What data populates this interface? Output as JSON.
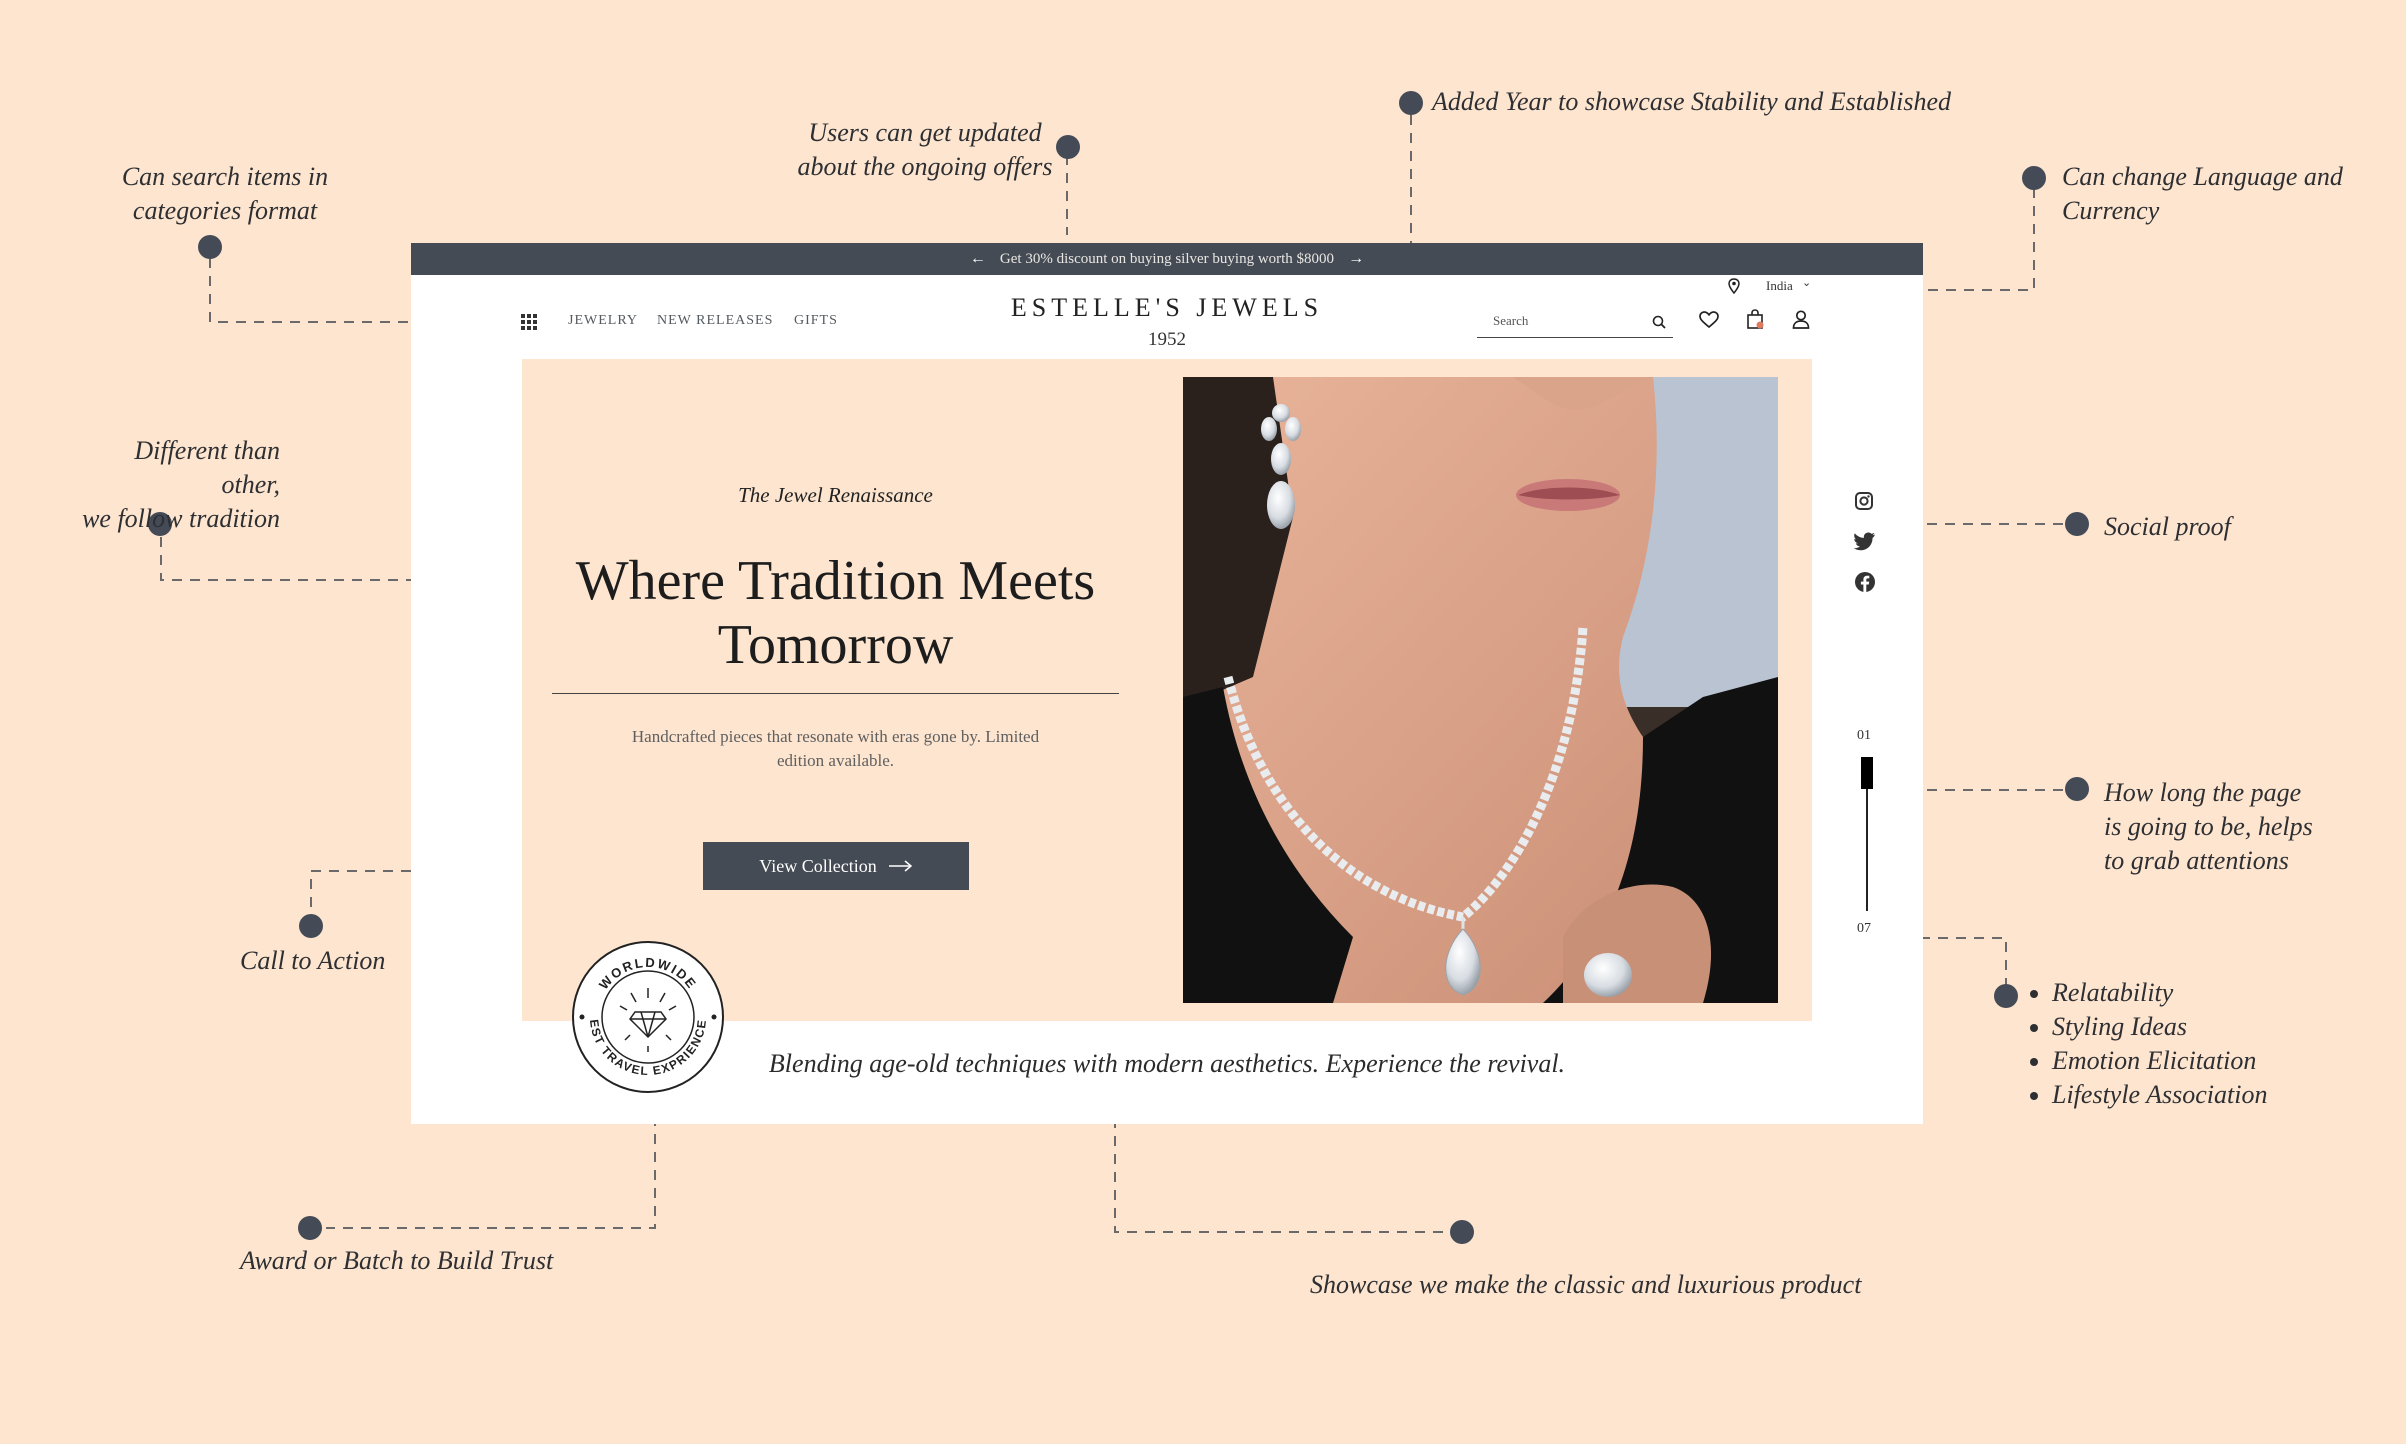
{
  "annotations": {
    "categories": "Can search items in categories format",
    "offers_line1": "Users can get updated",
    "offers_line2": "about the ongoing offers",
    "year": "Added Year to showcase Stability and Established",
    "language_line1": "Can change Language and",
    "language_line2": "Currency",
    "tradition_line1": "Different than other,",
    "tradition_line2": "we follow tradition",
    "social_proof": "Social proof",
    "page_length_line1": "How long the page",
    "page_length_line2": "is going to be, helps",
    "page_length_line3": "to grab attentions",
    "cta": "Call to Action",
    "image_points": [
      "Relatability",
      "Styling Ideas",
      "Emotion Elicitation",
      "Lifestyle Association"
    ],
    "award": "Award or Batch to Build Trust",
    "showcase": "Showcase we make the classic and luxurious product"
  },
  "site": {
    "offer_bar": "Get 30% discount on buying silver buying worth $8000",
    "nav": [
      "JEWELRY",
      "NEW RELEASES",
      "GIFTS"
    ],
    "brand": "ESTELLE'S JEWELS",
    "year": "1952",
    "region": "India",
    "search_placeholder": "Search",
    "hero": {
      "eyebrow": "The Jewel Renaissance",
      "headline_line1": "Where Tradition Meets",
      "headline_line2": "Tomorrow",
      "subtext_line1": "Handcrafted pieces that resonate with eras gone by. Limited",
      "subtext_line2": "edition available.",
      "cta": "View Collection"
    },
    "badge": {
      "top": "WORLDWIDE",
      "bottom": "BEST TRAVEL EXPRIENCES"
    },
    "tagline": "Blending age-old techniques with modern aesthetics. Experience the revival.",
    "pager": {
      "current": "01",
      "total": "07",
      "progress": 0.14
    },
    "icons": [
      "grid-icon",
      "location-pin-icon",
      "chevron-down-icon",
      "search-icon",
      "heart-icon",
      "bag-icon",
      "user-icon",
      "instagram-icon",
      "twitter-icon",
      "facebook-icon",
      "arrow-right-icon"
    ]
  },
  "colors": {
    "background": "#fde5cf",
    "dark": "#454b54",
    "dot": "#444b57"
  }
}
